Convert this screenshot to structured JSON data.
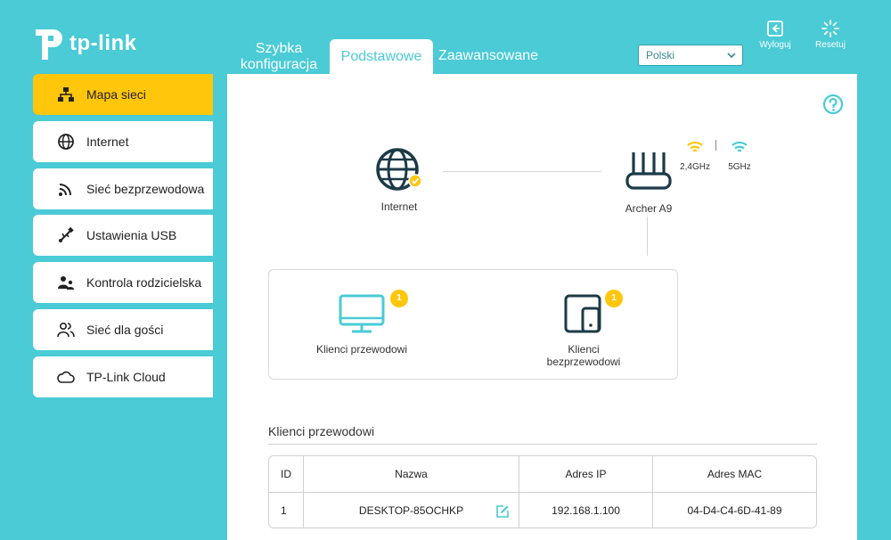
{
  "brand": {
    "logo_text": "tp-link"
  },
  "tabs": [
    {
      "line1": "Szybka",
      "line2": "konfiguracja"
    },
    {
      "label": "Podstawowe"
    },
    {
      "label": "Zaawansowane"
    }
  ],
  "language": {
    "selected": "Polski"
  },
  "header_buttons": {
    "logout": "Wyloguj",
    "reset": "Resetuj"
  },
  "sidebar": {
    "items": [
      {
        "label": "Mapa sieci",
        "icon": "network-map-icon"
      },
      {
        "label": "Internet",
        "icon": "globe-icon"
      },
      {
        "label": "Sieć bezprzewodowa",
        "icon": "wifi-icon"
      },
      {
        "label": "Ustawienia USB",
        "icon": "usb-icon"
      },
      {
        "label": "Kontrola rodzicielska",
        "icon": "parental-icon"
      },
      {
        "label": "Sieć dla gości",
        "icon": "guests-icon"
      },
      {
        "label": "TP-Link Cloud",
        "icon": "cloud-icon"
      }
    ]
  },
  "map": {
    "internet_label": "Internet",
    "router_label": "Archer A9",
    "band_24": "2,4GHz",
    "band_5": "5GHz",
    "wired_label": "Klienci przewodowi",
    "wired_count": "1",
    "wireless_line1": "Klienci",
    "wireless_line2": "bezprzewodowi",
    "wireless_count": "1"
  },
  "table": {
    "section_title": "Klienci przewodowi",
    "headers": {
      "id": "ID",
      "name": "Nazwa",
      "ip": "Adres IP",
      "mac": "Adres MAC"
    },
    "rows": [
      {
        "id": "1",
        "name": "DESKTOP-85OCHKP",
        "ip": "192.168.1.100",
        "mac": "04-D4-C4-6D-41-89"
      }
    ]
  },
  "colors": {
    "teal": "#4acbd6",
    "yellow": "#ffc60b",
    "dark": "#1c3a47"
  }
}
